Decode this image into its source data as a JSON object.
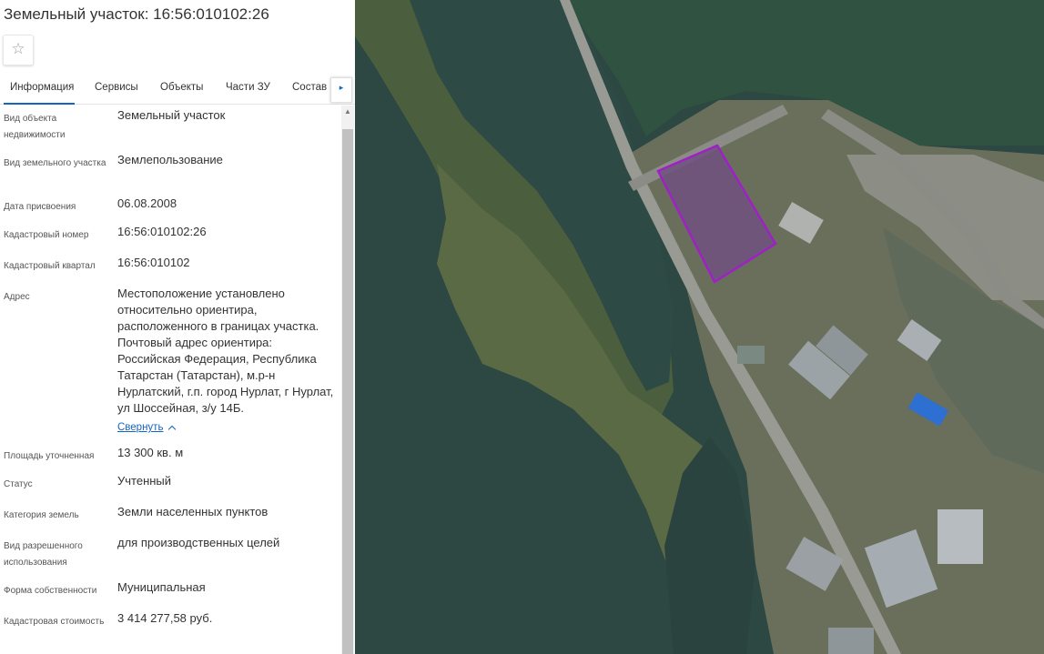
{
  "header": {
    "title": "Земельный участок: 16:56:010102:26"
  },
  "favorite": {
    "icon": "☆"
  },
  "tabs": [
    {
      "label": "Информация",
      "active": true
    },
    {
      "label": "Сервисы"
    },
    {
      "label": "Объекты"
    },
    {
      "label": "Части ЗУ"
    },
    {
      "label": "Состав"
    }
  ],
  "tab_next_icon": "▸",
  "scroll_up_icon": "▲",
  "colors": {
    "accent": "#1565c0",
    "parcel": "#a020c8"
  },
  "fields": {
    "object_type": {
      "label": "Вид объекта недвижимости",
      "value": "Земельный участок"
    },
    "land_type": {
      "label": "Вид земельного участка",
      "value": "Землепользование"
    },
    "assigned_date": {
      "label": "Дата присвоения",
      "value": "06.08.2008"
    },
    "cadastral_number": {
      "label": "Кадастровый номер",
      "value": "16:56:010102:26"
    },
    "cadastral_block": {
      "label": "Кадастровый квартал",
      "value": "16:56:010102"
    },
    "address": {
      "label": "Адрес",
      "value": "Местоположение установлено относительно ориентира, расположенного в границах участка. Почтовый адрес ориентира: Российская Федерация, Республика Татарстан (Татарстан), м.р-н Нурлатский, г.п. город Нурлат, г Нурлат, ул Шоссейная, з/у 14Б."
    },
    "collapse": "Свернуть",
    "area": {
      "label": "Площадь уточненная",
      "value": "13 300 кв. м"
    },
    "status": {
      "label": "Статус",
      "value": "Учтенный"
    },
    "land_category": {
      "label": "Категория земель",
      "value": "Земли населенных пунктов"
    },
    "permitted_use": {
      "label": "Вид разрешенного использования",
      "value": "для производственных целей"
    },
    "ownership": {
      "label": "Форма собственности",
      "value": "Муниципальная"
    },
    "cadastral_value": {
      "label": "Кадастровая стоимость",
      "value": "3 414 277,58 руб."
    }
  }
}
